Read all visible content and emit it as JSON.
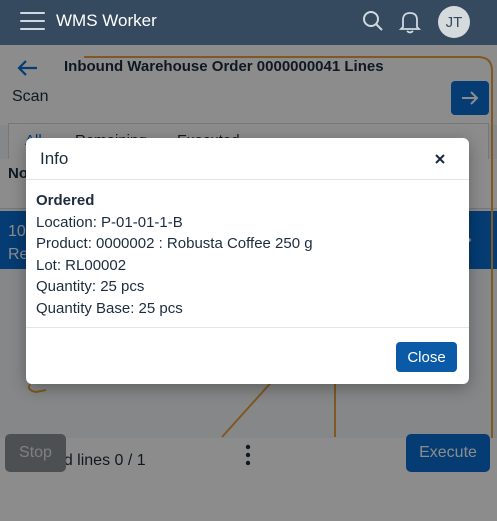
{
  "shell": {
    "title": "WMS Worker",
    "avatar_initials": "JT",
    "icons": {
      "menu": "hamburger-icon",
      "search": "search-icon",
      "notifications": "bell-icon"
    }
  },
  "page": {
    "title": "Inbound Warehouse Order 0000000041 Lines",
    "scan_label": "Scan",
    "tabs": [
      {
        "label": "All"
      },
      {
        "label": "Remaining"
      },
      {
        "label": "Executed"
      }
    ],
    "table": {
      "header_no": "No",
      "rows": [
        {
          "no": "10",
          "sub": "Re"
        }
      ]
    }
  },
  "footer": {
    "executed_lines": "Executed lines 0 / 1",
    "stop_label": "Stop",
    "execute_label": "Execute"
  },
  "dialog": {
    "title": "Info",
    "heading": "Ordered",
    "lines": [
      "Location: P-01-01-1-B",
      "Product: 0000002 : Robusta Coffee 250 g",
      "Lot: RL00002",
      "Quantity: 25 pcs",
      "Quantity Base: 25 pcs"
    ],
    "close_label": "Close"
  },
  "colors": {
    "shell_bg": "#354a5f",
    "accent": "#0a6ed1",
    "dialog_button": "#0a5aa8"
  }
}
